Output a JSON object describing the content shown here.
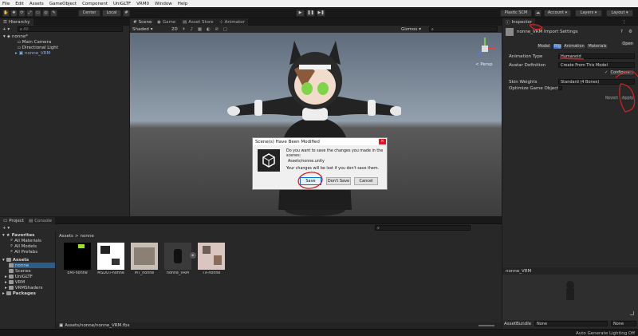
{
  "menu": [
    "File",
    "Edit",
    "Assets",
    "GameObject",
    "Component",
    "UniGLTF",
    "VRM0",
    "Window",
    "Help"
  ],
  "toolbar": {
    "center": "Center",
    "local": "Local",
    "plastic": "Plastic SCM",
    "account": "Account",
    "layers": "Layers",
    "layout": "Layout"
  },
  "hierarchy": {
    "title": "Hierarchy",
    "search_placeholder": "All",
    "scene": "nonne*",
    "items": [
      "Main Camera",
      "Directional Light",
      "nonne_VRM"
    ]
  },
  "scene_tabs": {
    "scene": "Scene",
    "game": "Game",
    "asset_store": "Asset Store",
    "animator": "Animator",
    "shaded": "Shaded",
    "mode_2d": "2D",
    "gizmos": "Gizmos",
    "persp": "< Persp"
  },
  "dialog": {
    "title": "Scene(s) Have Been Modified",
    "message": "Do you want to save the changes you made in the scenes:",
    "path": "Assets/nonne.unity",
    "warning": "Your changes will be lost if you don't save them.",
    "save": "Save",
    "dont_save": "Don't Save",
    "cancel": "Cancel"
  },
  "project": {
    "tab_project": "Project",
    "tab_console": "Console",
    "favorites": "Favorites",
    "fav_items": [
      "All Materials",
      "All Models",
      "All Prefabs"
    ],
    "assets": "Assets",
    "asset_items": [
      "nonne",
      "Scenes",
      "UniGLTF",
      "VRM",
      "VRMShaders"
    ],
    "packages": "Packages",
    "breadcrumb_root": "Assets",
    "breadcrumb_sep": ">",
    "breadcrumb_folder": "nonne",
    "thumbnails": [
      "EMI-nonne",
      "MSDUT-nonne",
      "MT_nonne",
      "nonne_VRM",
      "TX-nonne"
    ],
    "status_path": "Assets/nonne/nonne_VRM.fbx"
  },
  "inspector": {
    "title": "Inspector",
    "asset_name": "nonne_VRM Import Settings",
    "open": "Open",
    "tabs": [
      "Model",
      "Rig",
      "Animation",
      "Materials"
    ],
    "animation_type_label": "Animation Type",
    "animation_type_value": "Humanoid",
    "avatar_def_label": "Avatar Definition",
    "avatar_def_value": "Create From This Model",
    "configure": "Configure...",
    "skin_weights_label": "Skin Weights",
    "skin_weights_value": "Standard (4 Bones)",
    "optimize_label": "Optimize Game Objects",
    "revert": "Revert",
    "apply": "Apply",
    "preview_name": "nonne_VRM",
    "asset_bundle_label": "AssetBundle",
    "asset_bundle_value": "None",
    "asset_bundle_variant": "None"
  },
  "status": {
    "lighting": "Auto Generate Lighting Off"
  },
  "colors": {
    "accent": "#4d7bc4",
    "annotation": "#d42020",
    "panel": "#282828"
  }
}
